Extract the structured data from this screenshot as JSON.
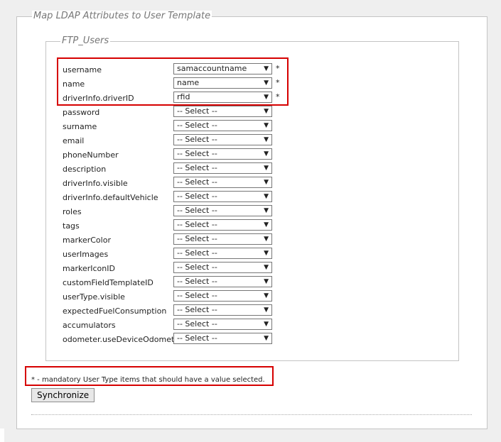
{
  "outer_legend": "Map LDAP Attributes to User Template",
  "inner_legend": "FTP_Users",
  "rows": [
    {
      "label": "username",
      "value": "samaccountname",
      "required": "*"
    },
    {
      "label": "name",
      "value": "name",
      "required": "*"
    },
    {
      "label": "driverInfo.driverID",
      "value": "rfid",
      "required": "*"
    },
    {
      "label": "password",
      "value": "-- Select --",
      "required": ""
    },
    {
      "label": "surname",
      "value": "-- Select --",
      "required": ""
    },
    {
      "label": "email",
      "value": "-- Select --",
      "required": ""
    },
    {
      "label": "phoneNumber",
      "value": "-- Select --",
      "required": ""
    },
    {
      "label": "description",
      "value": "-- Select --",
      "required": ""
    },
    {
      "label": "driverInfo.visible",
      "value": "-- Select --",
      "required": ""
    },
    {
      "label": "driverInfo.defaultVehicle",
      "value": "-- Select --",
      "required": ""
    },
    {
      "label": "roles",
      "value": "-- Select --",
      "required": ""
    },
    {
      "label": "tags",
      "value": "-- Select --",
      "required": ""
    },
    {
      "label": "markerColor",
      "value": "-- Select --",
      "required": ""
    },
    {
      "label": "userImages",
      "value": "-- Select --",
      "required": ""
    },
    {
      "label": "markerIconID",
      "value": "-- Select --",
      "required": ""
    },
    {
      "label": "customFieldTemplateID",
      "value": "-- Select --",
      "required": ""
    },
    {
      "label": "userType.visible",
      "value": "-- Select --",
      "required": ""
    },
    {
      "label": "expectedFuelConsumption",
      "value": "-- Select --",
      "required": ""
    },
    {
      "label": "accumulators",
      "value": "-- Select --",
      "required": ""
    },
    {
      "label": "odometer.useDeviceOdometer",
      "value": "-- Select --",
      "required": ""
    }
  ],
  "note": "* - mandatory User Type items that should have a value selected.",
  "sync_label": "Synchronize",
  "colors": {
    "highlight": "#d60000"
  },
  "icons": {
    "dropdown": "chevron-down-icon"
  }
}
